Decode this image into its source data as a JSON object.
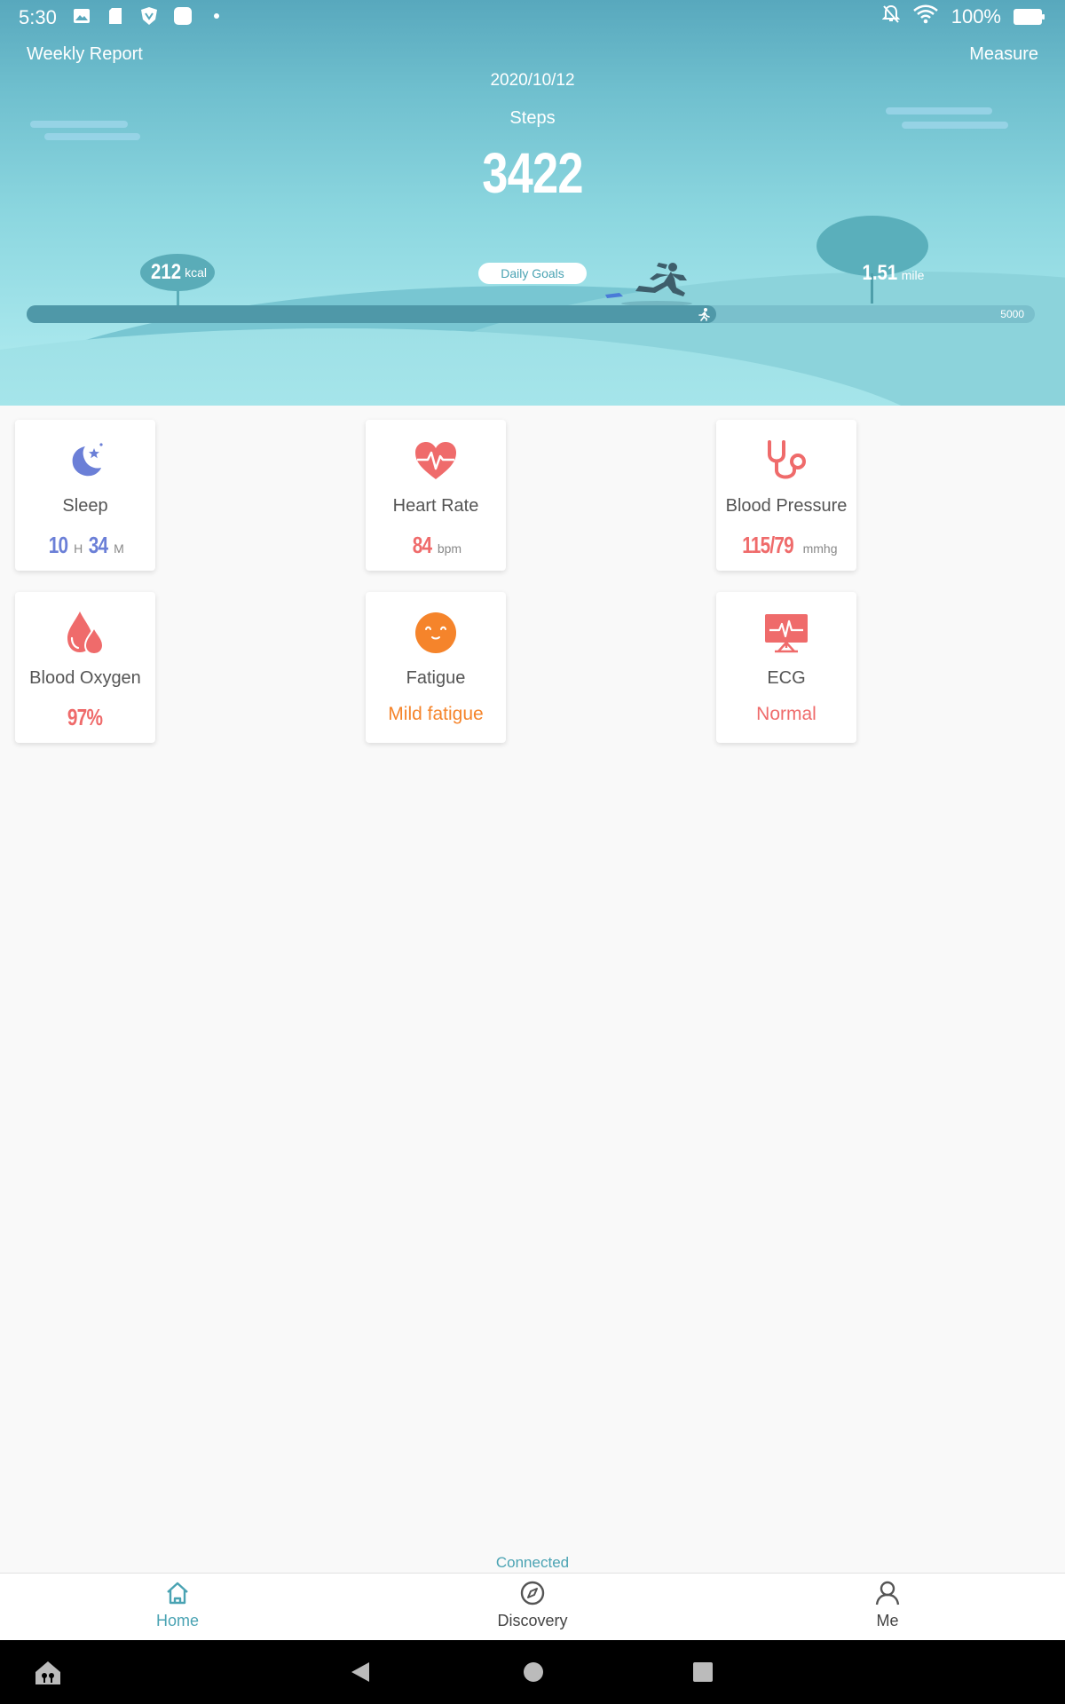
{
  "status_bar": {
    "time": "5:30",
    "battery": "100%",
    "icons": [
      "image-icon",
      "sd-card-icon",
      "vpn-shield-icon",
      "app-icon",
      "notification-dot-icon",
      "bell-off-icon",
      "wifi-icon",
      "battery-icon"
    ]
  },
  "header": {
    "weekly_report": "Weekly Report",
    "measure": "Measure",
    "date": "2020/10/12",
    "steps_label": "Steps",
    "steps_value": "3422"
  },
  "scene": {
    "kcal_value": "212",
    "kcal_unit": "kcal",
    "mile_value": "1.51",
    "mile_unit": "mile",
    "daily_goals_label": "Daily Goals",
    "goal_value": "5000",
    "progress_fraction": 0.6844
  },
  "cards": [
    {
      "title": "Sleep",
      "icon": "moon-star-icon",
      "value_hours": "10",
      "unit_hours": "H",
      "value_minutes": "34",
      "unit_minutes": "M",
      "color": "#6b7fd7"
    },
    {
      "title": "Heart Rate",
      "icon": "heart-pulse-icon",
      "value": "84",
      "unit": "bpm",
      "color": "#ef6b6b"
    },
    {
      "title": "Blood Pressure",
      "icon": "stethoscope-icon",
      "value": "115/79",
      "unit": "mmhg",
      "color": "#ef6b6b"
    },
    {
      "title": "Blood Oxygen",
      "icon": "blood-drops-icon",
      "value": "97%",
      "color": "#ef6b6b"
    },
    {
      "title": "Fatigue",
      "icon": "smiley-face-icon",
      "value": "Mild fatigue",
      "color": "#f5842b"
    },
    {
      "title": "ECG",
      "icon": "ecg-monitor-icon",
      "value": "Normal",
      "color": "#ef6b6b"
    }
  ],
  "connection_status": "Connected",
  "bottom_nav": [
    {
      "label": "Home",
      "icon": "home-icon",
      "active": true
    },
    {
      "label": "Discovery",
      "icon": "compass-icon",
      "active": false
    },
    {
      "label": "Me",
      "icon": "person-icon",
      "active": false
    }
  ],
  "colors": {
    "accent": "#4aa3b3",
    "inactive_nav": "#444444"
  }
}
